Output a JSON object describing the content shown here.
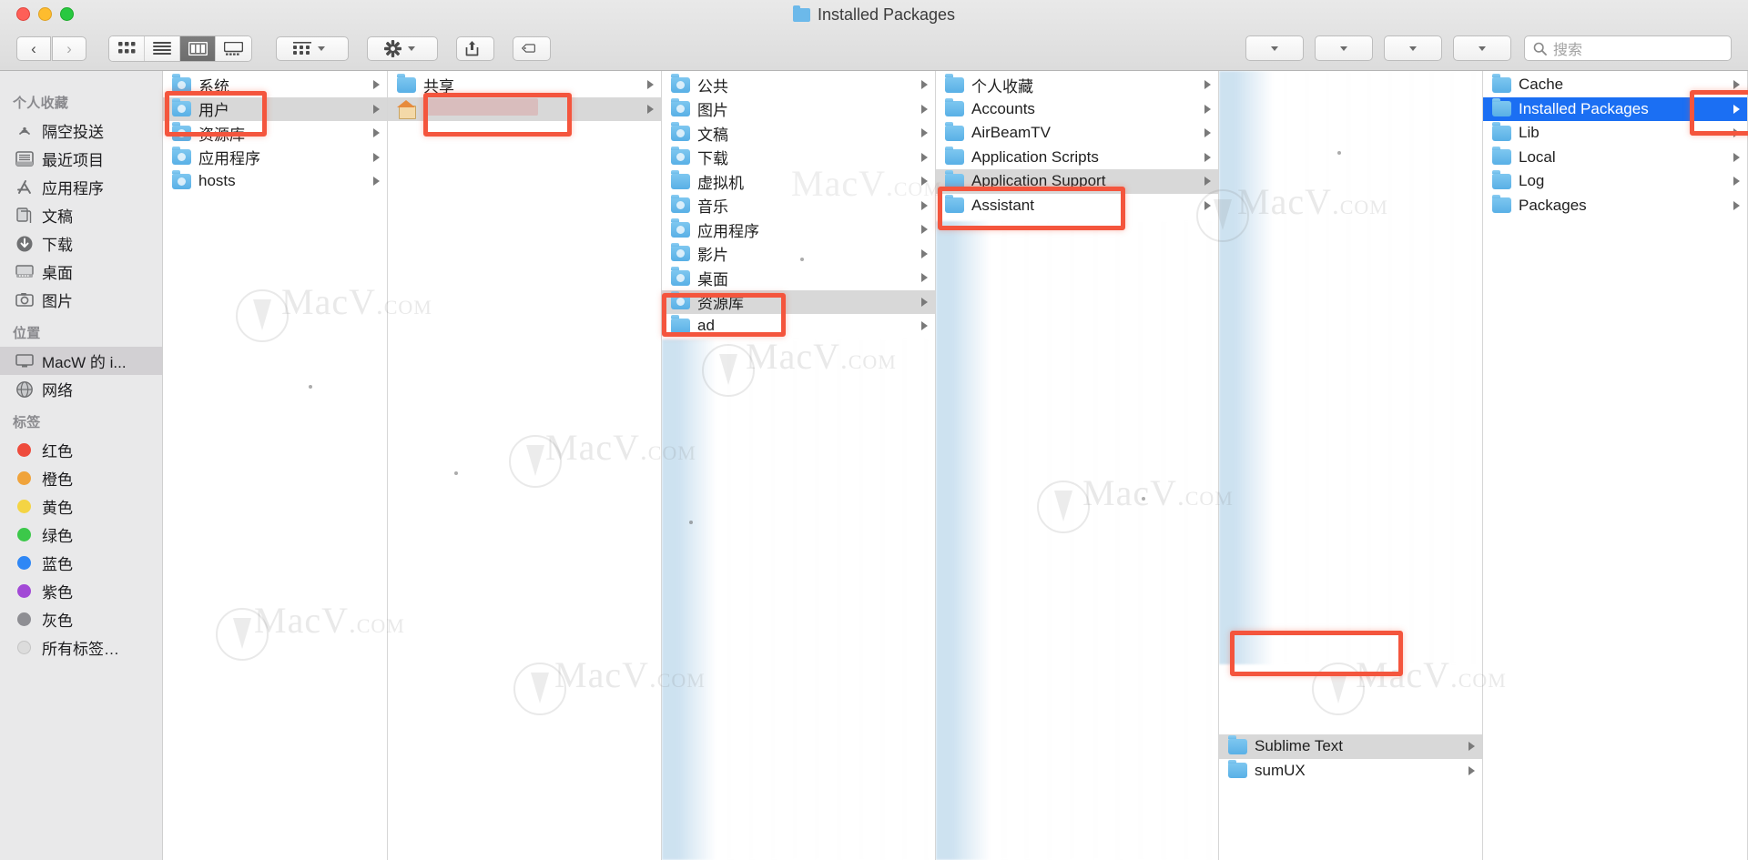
{
  "window": {
    "title": "Installed Packages",
    "traffic_lights": [
      "close",
      "minimize",
      "zoom"
    ]
  },
  "toolbar": {
    "back_label": "‹",
    "forward_label": "›",
    "view_modes": [
      {
        "name": "icon-view",
        "selected": false
      },
      {
        "name": "list-view",
        "selected": false
      },
      {
        "name": "column-view",
        "selected": true
      },
      {
        "name": "gallery-view",
        "selected": false
      }
    ],
    "arrange_label": "",
    "action_label": "",
    "share_label": "",
    "tag_label": "",
    "empty_menus": [
      "",
      "",
      "",
      ""
    ],
    "search_placeholder": "搜索"
  },
  "sidebar": {
    "sections": [
      {
        "header": "个人收藏",
        "items": [
          {
            "label": "隔空投送",
            "icon": "airdrop-icon",
            "selected": false
          },
          {
            "label": "最近项目",
            "icon": "recents-icon",
            "selected": false
          },
          {
            "label": "应用程序",
            "icon": "applications-icon",
            "selected": false
          },
          {
            "label": "文稿",
            "icon": "documents-icon",
            "selected": false
          },
          {
            "label": "下载",
            "icon": "downloads-icon",
            "selected": false
          },
          {
            "label": "桌面",
            "icon": "desktop-icon",
            "selected": false
          },
          {
            "label": "图片",
            "icon": "pictures-icon",
            "selected": false
          }
        ]
      },
      {
        "header": "位置",
        "items": [
          {
            "label": "MacW 的 i...",
            "icon": "computer-icon",
            "selected": true
          },
          {
            "label": "网络",
            "icon": "network-icon",
            "selected": false
          }
        ]
      },
      {
        "header": "标签",
        "items": [
          {
            "label": "红色",
            "icon": "tag-dot-icon",
            "color": "#ee4b3c",
            "selected": false
          },
          {
            "label": "橙色",
            "icon": "tag-dot-icon",
            "color": "#f0a33b",
            "selected": false
          },
          {
            "label": "黄色",
            "icon": "tag-dot-icon",
            "color": "#f4d444",
            "selected": false
          },
          {
            "label": "绿色",
            "icon": "tag-dot-icon",
            "color": "#3cc84a",
            "selected": false
          },
          {
            "label": "蓝色",
            "icon": "tag-dot-icon",
            "color": "#2f87f5",
            "selected": false
          },
          {
            "label": "紫色",
            "icon": "tag-dot-icon",
            "color": "#a249d6",
            "selected": false
          },
          {
            "label": "灰色",
            "icon": "tag-dot-icon",
            "color": "#8e8e93",
            "selected": false
          },
          {
            "label": "所有标签…",
            "icon": "tag-all-icon",
            "color": "#d8d8d8",
            "selected": false
          }
        ]
      }
    ]
  },
  "columns": [
    {
      "name": "column-root",
      "rows": [
        {
          "label": "系统",
          "icon": "folder-system-icon",
          "arrow": true,
          "state": "normal"
        },
        {
          "label": "用户",
          "icon": "folder-users-icon",
          "arrow": true,
          "state": "selected"
        },
        {
          "label": "资源库",
          "icon": "folder-library-icon",
          "arrow": true,
          "state": "normal"
        },
        {
          "label": "应用程序",
          "icon": "folder-applications-icon",
          "arrow": true,
          "state": "normal"
        },
        {
          "label": "hosts",
          "icon": "file-icon",
          "arrow": true,
          "state": "normal"
        }
      ]
    },
    {
      "name": "column-users",
      "rows": [
        {
          "label": "共享",
          "icon": "folder-shared-icon",
          "arrow": true,
          "state": "normal"
        },
        {
          "label": "",
          "icon": "home-icon",
          "arrow": true,
          "state": "selected",
          "redacted": true
        }
      ]
    },
    {
      "name": "column-home",
      "rows": [
        {
          "label": "公共",
          "icon": "folder-public-icon",
          "arrow": true,
          "state": "normal"
        },
        {
          "label": "图片",
          "icon": "folder-pictures-icon",
          "arrow": true,
          "state": "normal"
        },
        {
          "label": "文稿",
          "icon": "folder-documents-icon",
          "arrow": true,
          "state": "normal"
        },
        {
          "label": "下载",
          "icon": "folder-downloads-icon",
          "arrow": true,
          "state": "normal"
        },
        {
          "label": "虚拟机",
          "icon": "folder-icon",
          "arrow": true,
          "state": "normal"
        },
        {
          "label": "音乐",
          "icon": "folder-music-icon",
          "arrow": true,
          "state": "normal"
        },
        {
          "label": "应用程序",
          "icon": "folder-applications-icon",
          "arrow": true,
          "state": "normal"
        },
        {
          "label": "影片",
          "icon": "folder-movies-icon",
          "arrow": true,
          "state": "normal"
        },
        {
          "label": "桌面",
          "icon": "folder-desktop-icon",
          "arrow": true,
          "state": "normal"
        },
        {
          "label": "资源库",
          "icon": "folder-library-icon",
          "arrow": true,
          "state": "selected"
        },
        {
          "label": "ad",
          "icon": "folder-icon",
          "arrow": true,
          "state": "normal"
        }
      ]
    },
    {
      "name": "column-library",
      "rows": [
        {
          "label": "个人收藏",
          "icon": "folder-favorites-icon",
          "arrow": true,
          "state": "normal"
        },
        {
          "label": "Accounts",
          "icon": "folder-icon",
          "arrow": true,
          "state": "normal"
        },
        {
          "label": "AirBeamTV",
          "icon": "folder-icon",
          "arrow": true,
          "state": "normal"
        },
        {
          "label": "Application Scripts",
          "icon": "folder-icon",
          "arrow": true,
          "state": "normal"
        },
        {
          "label": "Application Support",
          "icon": "folder-icon",
          "arrow": true,
          "state": "selected"
        },
        {
          "label": "Assistant",
          "icon": "folder-icon",
          "arrow": true,
          "state": "normal"
        }
      ]
    },
    {
      "name": "column-application-support",
      "rows": [
        {
          "label": "Sublime Text",
          "icon": "folder-icon",
          "arrow": true,
          "state": "selected"
        },
        {
          "label": "sumUX",
          "icon": "folder-icon",
          "arrow": true,
          "state": "normal"
        }
      ]
    },
    {
      "name": "column-sublime-text",
      "rows": [
        {
          "label": "Cache",
          "icon": "folder-icon",
          "arrow": true,
          "state": "normal"
        },
        {
          "label": "Installed Packages",
          "icon": "folder-icon",
          "arrow": true,
          "state": "highlighted"
        },
        {
          "label": "Lib",
          "icon": "folder-icon",
          "arrow": true,
          "state": "normal"
        },
        {
          "label": "Local",
          "icon": "folder-icon",
          "arrow": true,
          "state": "normal"
        },
        {
          "label": "Log",
          "icon": "folder-icon",
          "arrow": true,
          "state": "normal"
        },
        {
          "label": "Packages",
          "icon": "folder-icon",
          "arrow": true,
          "state": "normal"
        }
      ]
    }
  ],
  "annotations": {
    "boxes": [
      {
        "name": "highlight-users-folder",
        "target": "用户"
      },
      {
        "name": "highlight-home-folder",
        "target": "home"
      },
      {
        "name": "highlight-library-folder",
        "target": "资源库"
      },
      {
        "name": "highlight-application-support",
        "target": "Application Support"
      },
      {
        "name": "highlight-sublime-text",
        "target": "Sublime Text"
      },
      {
        "name": "highlight-installed-packages",
        "target": "Installed Packages"
      }
    ]
  },
  "watermark": {
    "text": "MacV",
    "suffix": ".com"
  },
  "colors": {
    "selection_blue": "#1b6ff3",
    "annotation_red": "#f4553d",
    "folder_blue": "#59b0e6",
    "sidebar_bg": "#e9e9ea"
  }
}
